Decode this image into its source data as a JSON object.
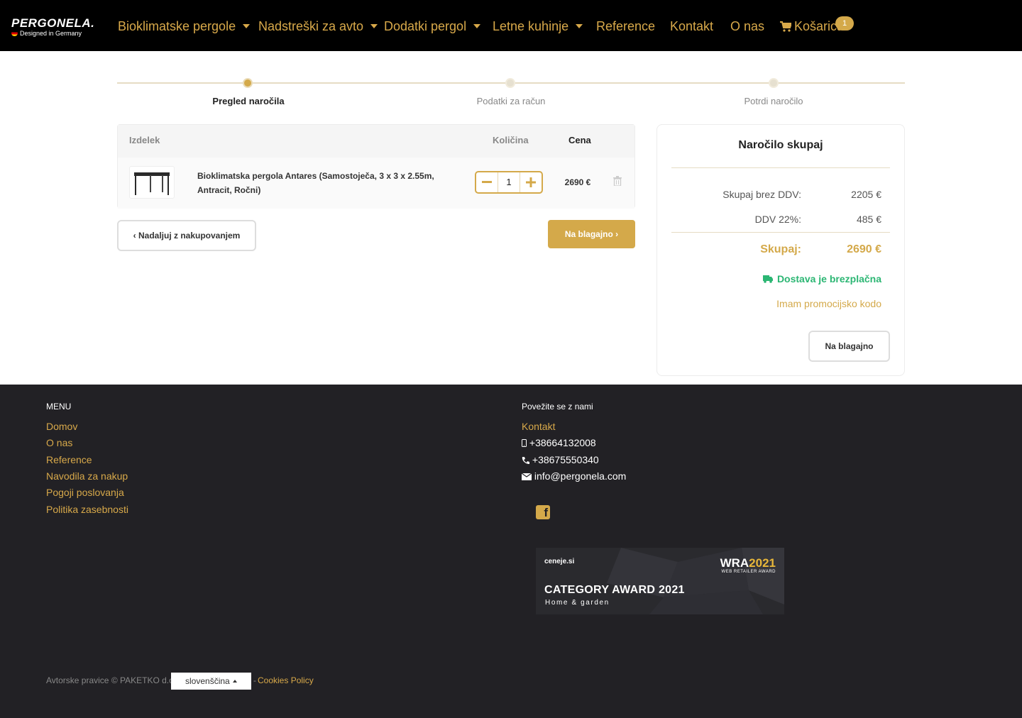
{
  "brand": {
    "name": "PERGONELA.",
    "tagline": "Designed in Germany"
  },
  "nav": {
    "items": [
      {
        "label": "Bioklimatske pergole"
      },
      {
        "label": "Nadstreški za avto"
      },
      {
        "label": "Dodatki pergol"
      },
      {
        "label": "Letne kuhinje"
      },
      {
        "label": "Reference"
      },
      {
        "label": "Kontakt"
      },
      {
        "label": "O nas"
      }
    ],
    "cart_label": "Košarica",
    "cart_count": "1"
  },
  "steps": [
    {
      "label": "Pregled naročila",
      "active": true
    },
    {
      "label": "Podatki za račun",
      "active": false
    },
    {
      "label": "Potrdi naročilo",
      "active": false
    }
  ],
  "cart": {
    "headers": {
      "product": "Izdelek",
      "quantity": "Količina",
      "price": "Cena"
    },
    "items": [
      {
        "name": "Bioklimatska pergola Antares (Samostoječa, 3 x 3 x 2.55m, Antracit, Ročni)",
        "quantity": "1",
        "price": "2690 €"
      }
    ],
    "continue_label": "Nadaljuj z nakupovanjem",
    "checkout_label": "Na blagajno"
  },
  "summary": {
    "title": "Naročilo skupaj",
    "subtotal_label": "Skupaj brez DDV:",
    "subtotal_value": "2205 €",
    "vat_label": "DDV 22%:",
    "vat_value": "485 €",
    "total_label": "Skupaj:",
    "total_value": "2690 €",
    "shipping_note": "Dostava je brezplačna",
    "promo_label": "Imam promocijsko kodo",
    "checkout_label": "Na blagajno"
  },
  "footer": {
    "menu_heading": "MENU",
    "menu_links": [
      "Domov",
      "O nas",
      "Reference",
      "Navodila za nakup",
      "Pogoji poslovanja",
      "Politika zasebnosti"
    ],
    "contact_heading": "Povežite se z nami",
    "contact_link": "Kontakt",
    "mobile": "+38664132008",
    "phone": "+38675550340",
    "email": "info@pergonela.com",
    "award": {
      "ceneje": "ceneje.si",
      "wra": "WRA",
      "wra_year": "2021",
      "wra_sub": "WEB RETAILER AWARD",
      "title": "CATEGORY AWARD 2021",
      "subtitle": "Home & garden"
    },
    "copyright": "Avtorske pravice © PAKETKO d.o.o.",
    "language": "slovenščina",
    "cookies": "Cookies Policy"
  },
  "colors": {
    "accent": "#d4a94a",
    "nav_bg": "#000000",
    "footer_bg": "#222125",
    "success": "#2bb673"
  }
}
